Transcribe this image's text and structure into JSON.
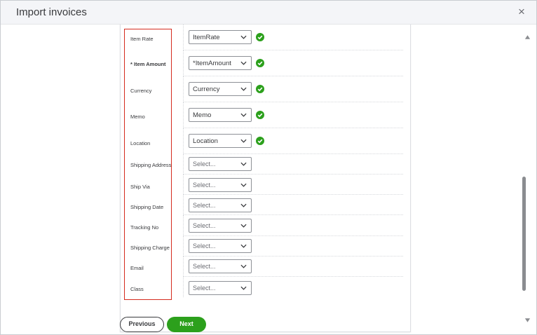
{
  "dialog": {
    "title": "Import invoices",
    "close_symbol": "×"
  },
  "fields": [
    {
      "label": "Item Rate",
      "required": false,
      "value": "ItemRate",
      "mapped": true
    },
    {
      "label": "* Item Amount",
      "required": true,
      "value": "*ItemAmount",
      "mapped": true
    },
    {
      "label": "Currency",
      "required": false,
      "value": "Currency",
      "mapped": true
    },
    {
      "label": "Memo",
      "required": false,
      "value": "Memo",
      "mapped": true
    },
    {
      "label": "Location",
      "required": false,
      "value": "Location",
      "mapped": true
    },
    {
      "label": "Shipping Address",
      "required": false,
      "value": "Select...",
      "mapped": false
    },
    {
      "label": "Ship Via",
      "required": false,
      "value": "Select...",
      "mapped": false
    },
    {
      "label": "Shipping Date",
      "required": false,
      "value": "Select...",
      "mapped": false
    },
    {
      "label": "Tracking No",
      "required": false,
      "value": "Select...",
      "mapped": false
    },
    {
      "label": "Shipping Charge",
      "required": false,
      "value": "Select...",
      "mapped": false
    },
    {
      "label": "Email",
      "required": false,
      "value": "Select...",
      "mapped": false
    },
    {
      "label": "Class",
      "required": false,
      "value": "Select...",
      "mapped": false
    }
  ],
  "footer": {
    "previous_label": "Previous",
    "next_label": "Next"
  },
  "colors": {
    "accent_green": "#2ca01c",
    "highlight_red": "#d52b1e",
    "check_green": "#2ca01c"
  }
}
